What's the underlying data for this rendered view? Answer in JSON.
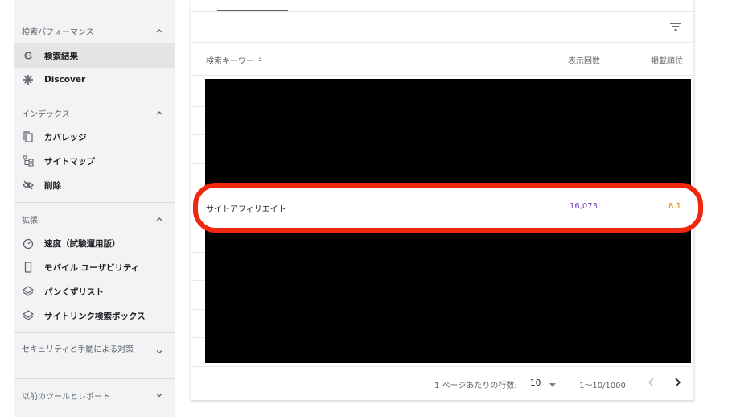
{
  "sidebar": {
    "sections": [
      {
        "title": "検索パフォーマンス",
        "items": [
          {
            "label": "検索結果",
            "icon": "google-g-icon",
            "active": true
          },
          {
            "label": "Discover",
            "icon": "asterisk-icon",
            "active": false
          }
        ]
      },
      {
        "title": "インデックス",
        "items": [
          {
            "label": "カバレッジ",
            "icon": "copy-icon"
          },
          {
            "label": "サイトマップ",
            "icon": "sitemap-icon"
          },
          {
            "label": "削除",
            "icon": "eye-off-icon"
          }
        ]
      },
      {
        "title": "拡張",
        "items": [
          {
            "label": "速度（試験運用版）",
            "icon": "speedometer-icon"
          },
          {
            "label": "モバイル ユーザビリティ",
            "icon": "phone-icon"
          },
          {
            "label": "パンくずリスト",
            "icon": "layers-icon"
          },
          {
            "label": "サイトリンク検索ボックス",
            "icon": "layers-icon"
          }
        ]
      },
      {
        "title": "セキュリティと手動による対策",
        "items": []
      },
      {
        "title": "以前のツールとレポート",
        "items": []
      }
    ]
  },
  "table": {
    "columns": [
      "検索キーワード",
      "表示回数",
      "掲載順位"
    ],
    "highlighted_row": {
      "keyword": "サイトアフィリエイト",
      "impressions": "16,073",
      "position": "8.1"
    }
  },
  "pagination": {
    "rows_per_page_label": "1 ページあたりの行数:",
    "rows_per_page": "10",
    "range": "1〜10/1000"
  },
  "colors": {
    "highlight_border": "#f0270f",
    "impressions": "#7b3fc4",
    "position": "#e37400",
    "sidebar_bg": "#f1f3f4"
  }
}
